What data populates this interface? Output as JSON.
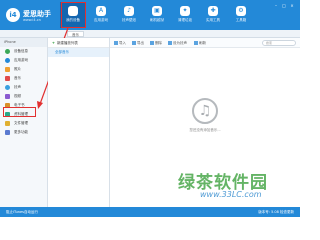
{
  "app": {
    "logo_glyph": "i4",
    "name": "爱思助手",
    "site": "www.i4.cn"
  },
  "nav": {
    "tabs": [
      {
        "label": "我的设备",
        "icon": "apple-icon",
        "glyph": "",
        "active": true
      },
      {
        "label": "应用游戏",
        "icon": "apps-icon",
        "glyph": "A"
      },
      {
        "label": "铃声壁纸",
        "icon": "bell-icon",
        "glyph": "♪"
      },
      {
        "label": "刷机越狱",
        "icon": "box-icon",
        "glyph": "▣"
      },
      {
        "label": "清理垃圾",
        "icon": "clean-icon",
        "glyph": "✦"
      },
      {
        "label": "实用工具",
        "icon": "tools-icon",
        "glyph": "✚"
      },
      {
        "label": "工具箱",
        "icon": "toolbox-icon",
        "glyph": "⚙"
      }
    ],
    "window_controls": [
      "–",
      "□",
      "×"
    ]
  },
  "subbar": {
    "tab_label": "音乐"
  },
  "sidebar": {
    "device": "iPhone",
    "items": [
      {
        "label": "设备信息",
        "icon": "info-icon",
        "color": "#3aa757"
      },
      {
        "label": "应用游戏",
        "icon": "apps-icon",
        "color": "#2389d8"
      },
      {
        "label": "照片",
        "icon": "photo-icon",
        "color": "#f0a030"
      },
      {
        "label": "音乐",
        "icon": "music-icon",
        "color": "#e24a4a"
      },
      {
        "label": "铃声",
        "icon": "ringtone-icon",
        "color": "#3aa0e0"
      },
      {
        "label": "视频",
        "icon": "video-icon",
        "color": "#8a5ad0"
      },
      {
        "label": "电子书",
        "icon": "book-icon",
        "color": "#d8902a"
      },
      {
        "label": "资料管理",
        "icon": "data-icon",
        "color": "#2aa88a"
      },
      {
        "label": "文件管理",
        "icon": "folder-icon",
        "color": "#e0b030"
      },
      {
        "label": "更多功能",
        "icon": "more-icon",
        "color": "#5a7ad0"
      }
    ]
  },
  "panel": {
    "new_list": "新建播放列表",
    "all_music": "全部音乐"
  },
  "toolbar": {
    "buttons": [
      "导入",
      "导出",
      "删除",
      "设为铃声",
      "刷新"
    ],
    "search_placeholder": "搜索"
  },
  "empty": {
    "icon": "music-note-icon",
    "glyph": "♫",
    "message": "您还没有添加音乐..."
  },
  "status": {
    "left": "阻止iTunes自动运行",
    "right": "版本号: 5.08  检查更新"
  },
  "watermark": {
    "text": "绿茶软件园",
    "url": "www.33LC.com"
  }
}
